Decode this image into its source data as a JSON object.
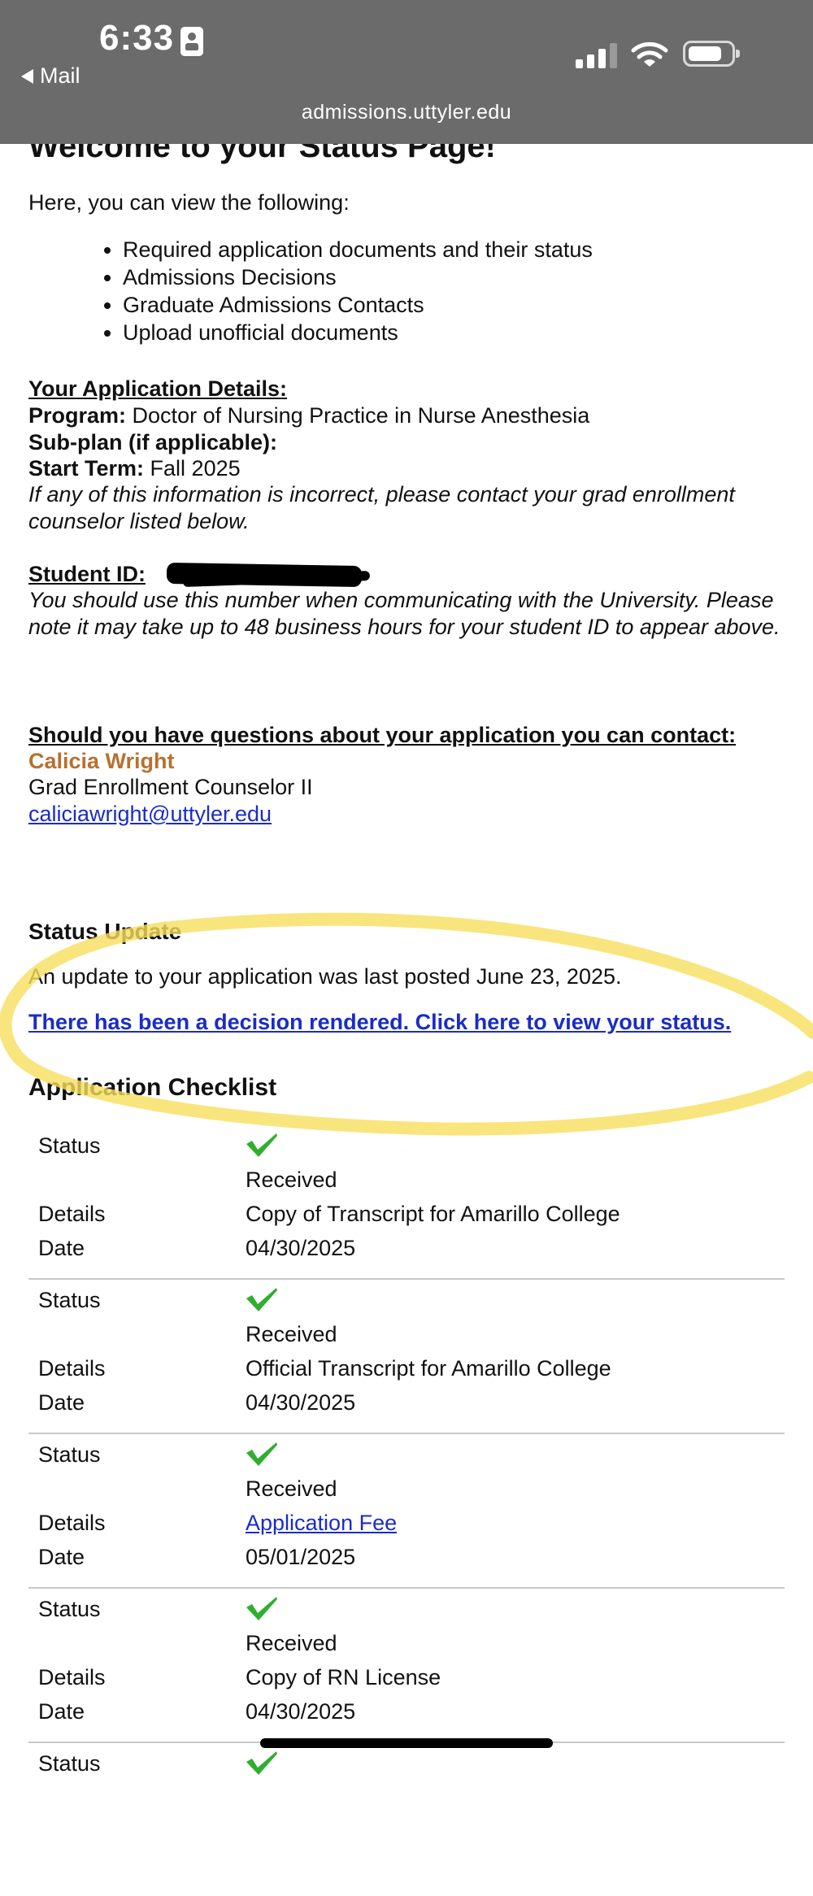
{
  "status_bar": {
    "time": "6:33",
    "back_label": "Mail",
    "url": "admissions.uttyler.edu"
  },
  "page": {
    "welcome": "Welcome to your Status Page!",
    "intro": "Here, you can view the following:",
    "features": [
      "Required application documents and their status",
      "Admissions Decisions",
      "Graduate Admissions Contacts",
      "Upload unofficial documents"
    ],
    "details_heading": "Your Application Details:",
    "program_label": "Program:",
    "program_value": "Doctor of Nursing Practice in Nurse Anesthesia",
    "subplan_label": "Sub-plan (if applicable):",
    "term_label": "Start Term:",
    "term_value": "Fall 2025",
    "incorrect_note": "If any of this information is incorrect, please contact your grad enrollment counselor listed below.",
    "student_id_label": "Student ID:",
    "id_note": "You should use this number when communicating with the University. Please note it may take up to 48 business hours for your student ID to appear above.",
    "contact_heading": "Should you have questions about your application you can contact:",
    "contact_name": "Calicia Wright",
    "contact_title": "Grad Enrollment Counselor II",
    "contact_email": "caliciawright@uttyler.edu",
    "status_heading": "Status Update",
    "status_update_text": "An update to your application was last posted June 23, 2025.",
    "decision_link": "There has been a decision rendered. Click here to view your status.",
    "checklist_heading": "Application Checklist"
  },
  "checklist_labels": {
    "status": "Status",
    "details": "Details",
    "date": "Date"
  },
  "checklist": [
    {
      "status": "Received",
      "details": "Copy of Transcript for Amarillo College",
      "date": "04/30/2025"
    },
    {
      "status": "Received",
      "details": "Official Transcript for Amarillo College",
      "date": "04/30/2025"
    },
    {
      "status": "Received",
      "details": "Application Fee",
      "date": "05/01/2025"
    },
    {
      "status": "Received",
      "details": "Copy of RN License",
      "date": "04/30/2025"
    },
    {
      "status": ""
    }
  ],
  "colors": {
    "header_bg": "#6b6b6b",
    "link": "#1a2cc7",
    "contact_name": "#b8702f",
    "check": "#2fae2f",
    "highlighter": "#f7df5e"
  }
}
